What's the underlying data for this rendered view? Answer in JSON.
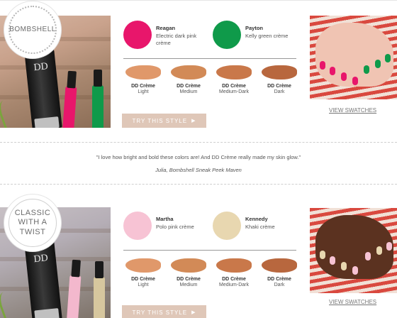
{
  "sections": [
    {
      "badge": "BOMBSHELL",
      "polishes": [
        {
          "name": "Reagan",
          "desc": "Electric dark pink crème",
          "color": "#e8166b"
        },
        {
          "name": "Payton",
          "desc": "Kelly green crème",
          "color": "#0f9a4a"
        }
      ],
      "dd_cremes": [
        {
          "label": "DD Crème",
          "shade": "Light",
          "color": "#e0986a"
        },
        {
          "label": "DD Crème",
          "shade": "Medium",
          "color": "#d28a57"
        },
        {
          "label": "DD Crème",
          "shade": "Medium-Dark",
          "color": "#c9784a"
        },
        {
          "label": "DD Crème",
          "shade": "Dark",
          "color": "#b8673e"
        }
      ],
      "try_button": "TRY THIS STYLE",
      "view_swatches": "VIEW SWATCHES",
      "product_text": "DD"
    },
    {
      "badge": "CLASSIC WITH A TWIST",
      "polishes": [
        {
          "name": "Martha",
          "desc": "Polo pink crème",
          "color": "#f7c3d4"
        },
        {
          "name": "Kennedy",
          "desc": "Khaki crème",
          "color": "#e8d7b0"
        }
      ],
      "dd_cremes": [
        {
          "label": "DD Crème",
          "shade": "Light",
          "color": "#e0986a"
        },
        {
          "label": "DD Crème",
          "shade": "Medium",
          "color": "#d28a57"
        },
        {
          "label": "DD Crème",
          "shade": "Medium-Dark",
          "color": "#c9784a"
        },
        {
          "label": "DD Crème",
          "shade": "Dark",
          "color": "#b8673e"
        }
      ],
      "try_button": "TRY THIS STYLE",
      "view_swatches": "VIEW SWATCHES",
      "product_text": "DD"
    }
  ],
  "quote": {
    "text": "\"I love how bright and bold these colors are! And DD Crème really made my skin glow.\"",
    "attribution": "Julia, Bombshell Sneak Peek Maven"
  },
  "colors": {
    "button_bg": "#dfc7b8",
    "rule": "#999999"
  }
}
